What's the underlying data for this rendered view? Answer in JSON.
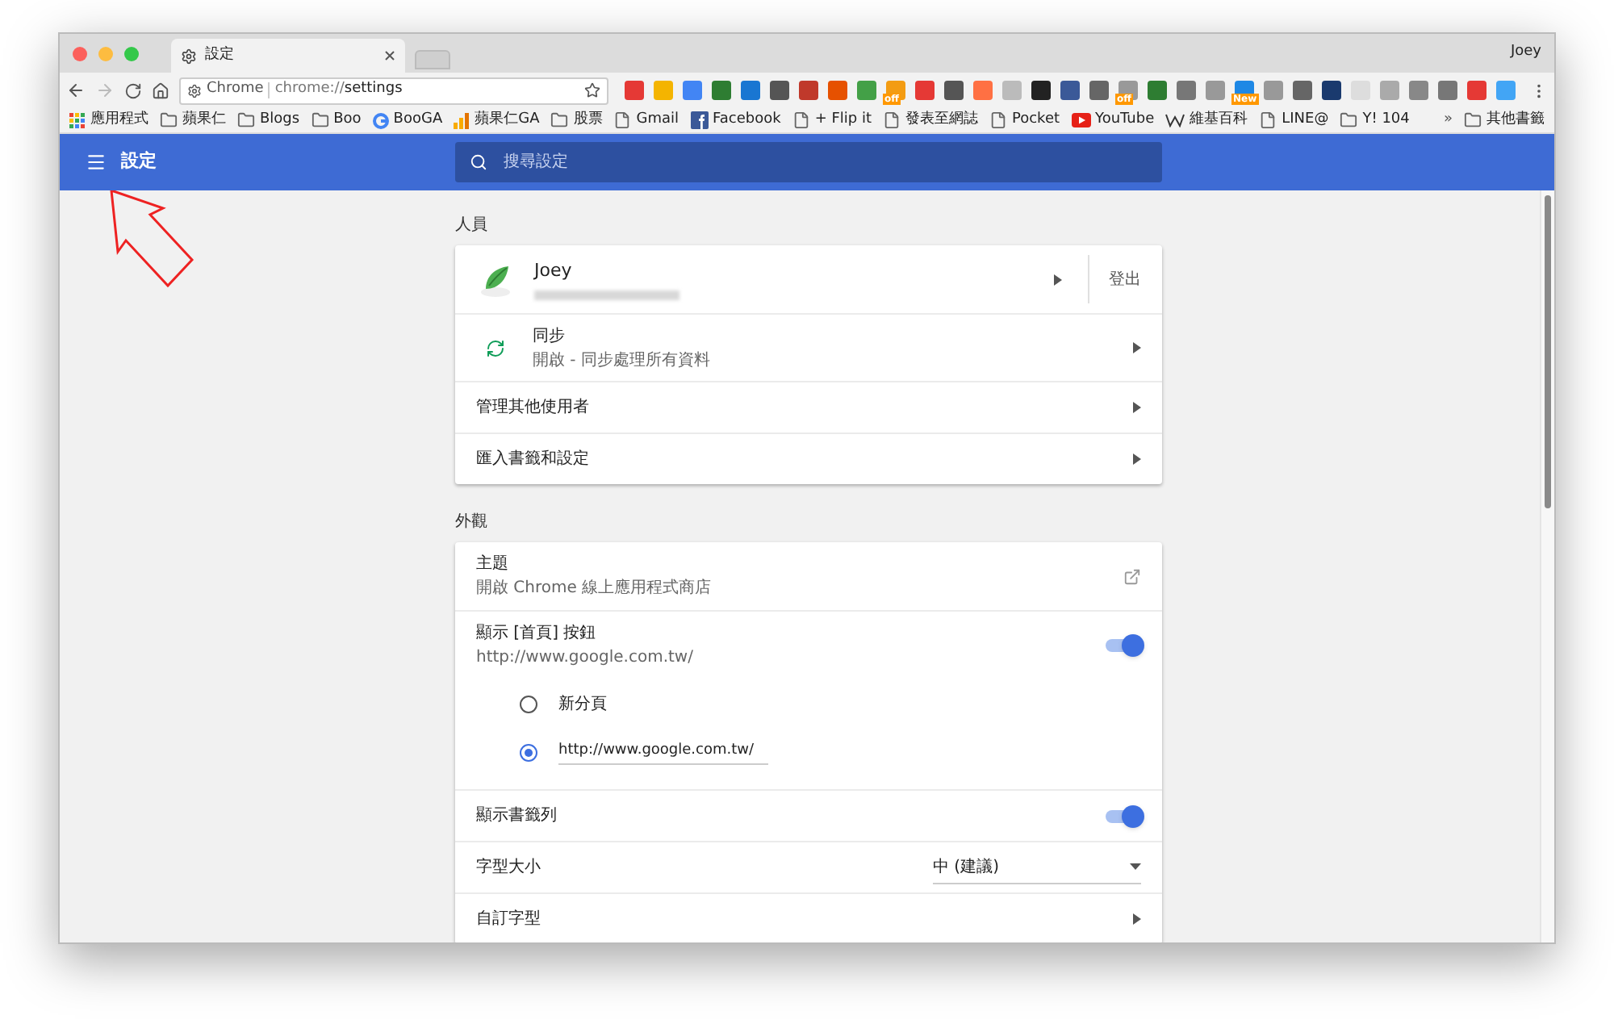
{
  "window": {
    "user": "Joey"
  },
  "tabs": [
    {
      "title": "設定",
      "selected": true
    }
  ],
  "address_bar": {
    "site": "Chrome",
    "url_prefix": "chrome://",
    "url_path": "settings"
  },
  "extensions": [
    {
      "color": "#e53935"
    },
    {
      "color": "#f4b400"
    },
    {
      "color": "#4285f4"
    },
    {
      "color": "#2e7d32"
    },
    {
      "color": "#1976d2"
    },
    {
      "color": "#555555"
    },
    {
      "color": "#c0392b"
    },
    {
      "color": "#e65100"
    },
    {
      "color": "#43a047"
    },
    {
      "color": "#f39c12",
      "label": "off"
    },
    {
      "color": "#e53935"
    },
    {
      "color": "#555555"
    },
    {
      "color": "#ff7043"
    },
    {
      "color": "#bbbbbb"
    },
    {
      "color": "#222222"
    },
    {
      "color": "#3b5998"
    },
    {
      "color": "#666666"
    },
    {
      "color": "#999999",
      "label": "off"
    },
    {
      "color": "#2e7d32"
    },
    {
      "color": "#777777"
    },
    {
      "color": "#999999"
    },
    {
      "color": "#1e88e5",
      "label": "New"
    },
    {
      "color": "#999999"
    },
    {
      "color": "#666666"
    },
    {
      "color": "#1a3a6e"
    },
    {
      "color": "#dddddd"
    },
    {
      "color": "#aaaaaa"
    },
    {
      "color": "#888888"
    },
    {
      "color": "#777777"
    },
    {
      "color": "#e53935"
    },
    {
      "color": "#42a5f5"
    }
  ],
  "bookmarks": [
    {
      "kind": "apps",
      "label": "應用程式"
    },
    {
      "kind": "folder",
      "label": "蘋果仁"
    },
    {
      "kind": "folder",
      "label": "Blogs"
    },
    {
      "kind": "folder",
      "label": "Boo"
    },
    {
      "kind": "google",
      "label": "BooGA"
    },
    {
      "kind": "analytics",
      "label": "蘋果仁GA"
    },
    {
      "kind": "folder",
      "label": "股票"
    },
    {
      "kind": "page",
      "label": "Gmail"
    },
    {
      "kind": "facebook",
      "label": "Facebook"
    },
    {
      "kind": "page",
      "label": "+ Flip it"
    },
    {
      "kind": "page",
      "label": "發表至網誌"
    },
    {
      "kind": "page",
      "label": "Pocket"
    },
    {
      "kind": "youtube",
      "label": "YouTube"
    },
    {
      "kind": "wiki",
      "label": "維基百科"
    },
    {
      "kind": "page",
      "label": "LINE@"
    },
    {
      "kind": "folder",
      "label": "Y! 104"
    }
  ],
  "bookmarks_overflow": "»",
  "other_bookmarks": "其他書籤",
  "header": {
    "title": "設定",
    "search_placeholder": "搜尋設定"
  },
  "sections": [
    {
      "title": "人員",
      "rows": [
        {
          "kind": "profile",
          "title": "Joey",
          "action": "登出"
        },
        {
          "kind": "sync",
          "title": "同步",
          "subtitle": "開啟 - 同步處理所有資料"
        },
        {
          "kind": "link",
          "title": "管理其他使用者"
        },
        {
          "kind": "link",
          "title": "匯入書籤和設定"
        }
      ]
    },
    {
      "title": "外觀",
      "rows": [
        {
          "kind": "external",
          "title": "主題",
          "subtitle": "開啟 Chrome 線上應用程式商店"
        },
        {
          "kind": "toggle",
          "title": "顯示 [首頁] 按鈕",
          "subtitle": "http://www.google.com.tw/",
          "on": true,
          "options": [
            {
              "kind": "label",
              "label": "新分頁",
              "selected": false
            },
            {
              "kind": "input",
              "label": "http://www.google.com.tw/",
              "selected": true
            }
          ]
        },
        {
          "kind": "toggle",
          "title": "顯示書籤列",
          "on": true
        },
        {
          "kind": "select",
          "title": "字型大小",
          "value": "中 (建議)"
        },
        {
          "kind": "link",
          "title": "自訂字型"
        }
      ]
    }
  ]
}
